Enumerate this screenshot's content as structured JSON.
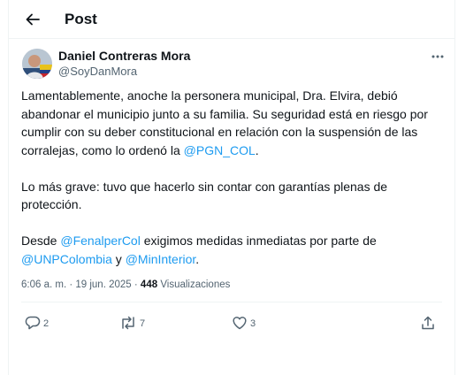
{
  "header": {
    "title": "Post",
    "back_icon": "arrow-left-icon"
  },
  "author": {
    "name": "Daniel Contreras Mora",
    "handle": "@SoyDanMora",
    "more_icon": "more-horizontal-icon"
  },
  "post": {
    "p1_text1": "Lamentablemente, anoche la personera municipal, Dra. Elvira, debió abandonar el municipio junto a su familia. Su seguridad está en riesgo por cumplir con su deber constitucional en relación con la suspensión de las corralejas, como lo ordenó la ",
    "p1_link": "@PGN_COL",
    "p1_text2": ".",
    "p2_text": "Lo más grave: tuvo que hacerlo sin contar con garantías plenas de protección.",
    "p3_text1": "Desde ",
    "p3_link1": "@FenalperCol",
    "p3_text2": " exigimos medidas inmediatas por parte de ",
    "p3_link2": "@UNPColombia",
    "p3_text3": " y ",
    "p3_link3": "@MinInterior",
    "p3_text4": "."
  },
  "meta": {
    "time": "6:06 a. m.",
    "separator": " · ",
    "date": "19 jun. 2025",
    "views_count": "448",
    "views_label": "Visualizaciones"
  },
  "actions": {
    "replies": "2",
    "reposts": "7",
    "likes": "3",
    "reply_icon": "reply-icon",
    "repost_icon": "repost-icon",
    "like_icon": "heart-icon",
    "share_icon": "share-icon"
  },
  "colors": {
    "link": "#1d9bf0",
    "secondary_text": "#536471",
    "divider": "#eff3f4"
  }
}
